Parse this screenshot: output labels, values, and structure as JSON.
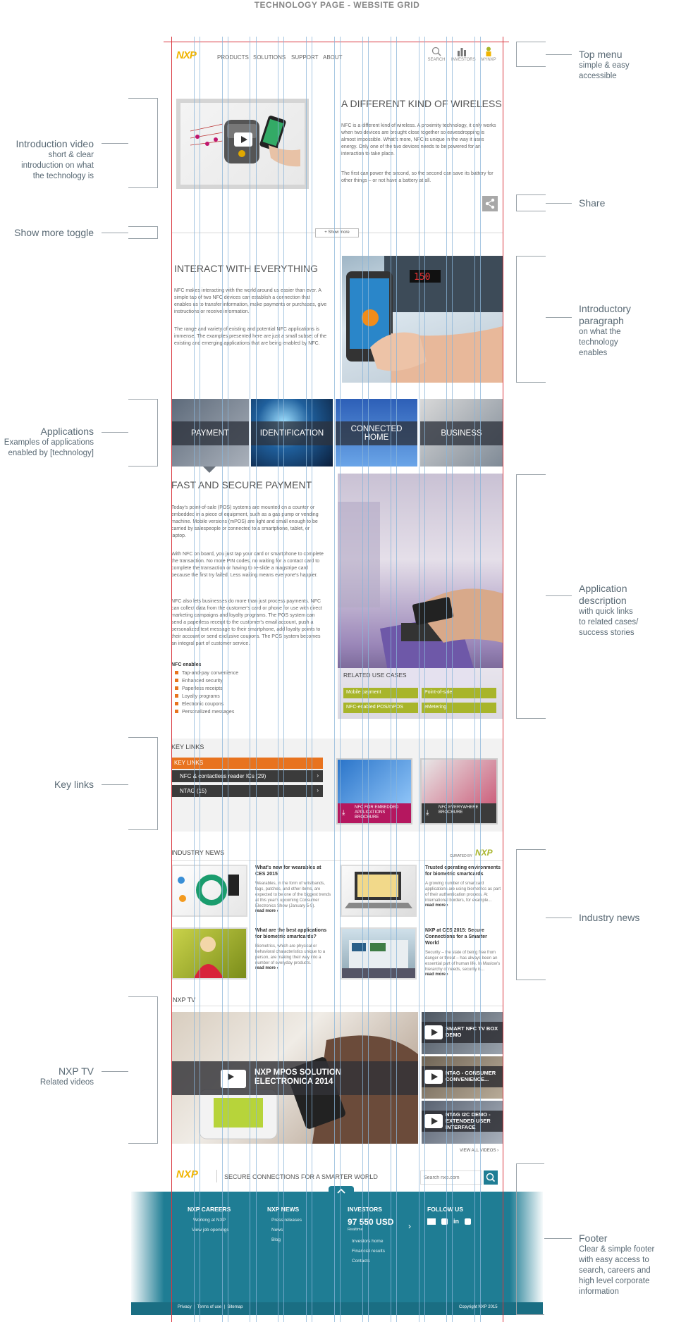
{
  "doc_title": "TECHNOLOGY PAGE - WEBSITE GRID",
  "annotations": {
    "top_menu": {
      "title": "Top menu",
      "lines": [
        "simple & easy",
        "accessible"
      ]
    },
    "intro_video": {
      "title": "Introduction video",
      "lines": [
        "short & clear",
        "introduction on what",
        "the technology is"
      ]
    },
    "share": {
      "title": "Share"
    },
    "show_more": {
      "title": "Show more toggle"
    },
    "intro_paragraph": {
      "title_lines": [
        "Introductory",
        "paragraph"
      ],
      "lines": [
        "on what the",
        "technology",
        "enables"
      ]
    },
    "applications": {
      "title": "Applications",
      "lines": [
        "Examples of applications",
        "enabled by [technology]"
      ]
    },
    "app_description": {
      "title_lines": [
        "Application",
        "description"
      ],
      "lines": [
        "with quick links",
        "to related cases/",
        "success stories"
      ]
    },
    "key_links": {
      "title": "Key links"
    },
    "industry_news": {
      "title": "Industry news"
    },
    "nxp_tv": {
      "title": "NXP TV",
      "lines": [
        "Related videos"
      ]
    },
    "footer": {
      "title": "Footer",
      "lines": [
        "Clear & simple footer",
        "with easy access to",
        "search, careers and",
        "high level corporate",
        "information"
      ]
    }
  },
  "nav": {
    "logo": "NXP",
    "items": [
      "PRODUCTS",
      "SOLUTIONS",
      "SUPPORT",
      "ABOUT"
    ],
    "icons": [
      {
        "label": "SEARCH",
        "icon": "search-icon"
      },
      {
        "label": "INVESTORS",
        "icon": "bar-chart-icon"
      },
      {
        "label": "MYNXP",
        "icon": "person-icon"
      }
    ]
  },
  "intro": {
    "title": "A DIFFERENT KIND OF WIRELESS",
    "p1": "NFC is a different kind of wireless. A proximity technology, it only works when two devices are brought close together so eavesdropping is almost impossible. What's more, NFC is unique in the way it uses energy. Only one of the two devices needs to be powered for an interaction to take place.",
    "p2": "The first can power the second, so the second can save its battery for other things – or not have a battery at all.",
    "show_more": "+ Show more"
  },
  "interact": {
    "title": "INTERACT WITH EVERYTHING",
    "p1": "NFC makes interacting with the world around us easier than ever. A simple tap of two NFC devices can establish a connection that enables us to transfer information, make payments or purchases, give instructions or receive information.",
    "p2": "The range and variety of existing and potential NFC applications is immense. The examples presented here are just a small subset of the existing and emerging applications that are being enabled by NFC."
  },
  "applications": [
    "PAYMENT",
    "IDENTIFICATION",
    "CONNECTED HOME",
    "BUSINESS"
  ],
  "payment": {
    "title": "FAST AND SECURE PAYMENT",
    "p1": "Today's point-of-sale (POS) systems are mounted on a counter or embedded in a piece of equipment, such as a gas pump or vending machine. Mobile versions (mPOS) are light and small enough to be carried by salespeople or connected to a smartphone, tablet, or laptop.",
    "p2": "With NFC on board, you just tap your card or smartphone to complete the transaction. No more PIN codes, no waiting for a contact card to complete the transaction or having to re-slide a magstripe card because the first try failed. Less waiting means everyone's happier.",
    "p3": "NFC also lets businesses do more than just process payments. NFC can collect data from the customer's card or phone for use with direct marketing campaigns and loyalty programs. The POS system can send a paperless receipt to the customer's email account, push a personalized text message to their smartphone, add loyalty points to their account or send exclusive coupons. The POS system becomes an integral part of customer service.",
    "enables_title": "NFC enables",
    "enables": [
      "Tap-and-pay convenience",
      "Enhanced security",
      "Paperless receipts",
      "Loyalty programs",
      "Electronic coupons",
      "Personalized messages"
    ],
    "related_title": "RELATED USE CASES",
    "related": [
      "Mobile payment",
      "Point-of-sale",
      "NFC-enabled POS/mPOS",
      "eMetering"
    ]
  },
  "key_links": {
    "title": "KEY LINKS",
    "header": "KEY LINKS",
    "rows": [
      "NFC & contactless reader ICs (29)",
      "NTAG (15)"
    ],
    "brochures": [
      "NFC FOR EMBEDDED APPLICATIONS BROCHURE",
      "NFC EVERYWHERE BROCHURE"
    ]
  },
  "news": {
    "title": "INDUSTRY NEWS",
    "curated": "CURATED BY",
    "read_more": "read more ›",
    "items": [
      {
        "title": "What's new for wearables at CES 2015",
        "body": "Wearables, in the form of wristbands, tags, patches, and other items, are expected to be one of the biggest trends at this year's upcoming Consumer Electronics Show (January 5-9)."
      },
      {
        "title": "Trusted operating environments for biometric smartcards",
        "body": "A growing number of smartcard applications are using biometrics as part of their authentication process. At international borders, for example..."
      },
      {
        "title": "What are the best applications for biometric smartcards?",
        "body": "Biometrics, which are physical or behavioral characteristics unique to a person, are making their way into a number of everyday products."
      },
      {
        "title": "NXP at CES 2015: Secure Connections for a Smarter World",
        "body": "Security – the state of being free from danger or threat – has always been an essential part of human life. In Maslow's hierarchy of needs, security is..."
      }
    ]
  },
  "tv": {
    "title": "NXP TV",
    "main": "NXP MPOS SOLUTION ELECTRONICA 2014",
    "side": [
      "SMART NFC TV BOX DEMO",
      "NTAG - CONSUMER CONVENIENCE...",
      "NTAG I2C DEMO - EXTENDED USER INTERFACE"
    ],
    "view_all": "VIEW ALL VIDEOS ›"
  },
  "footer": {
    "logo": "NXP",
    "tagline": "SECURE CONNECTIONS FOR A SMARTER WORLD",
    "search_placeholder": "Search nxp.com",
    "cols": [
      {
        "title": "NXP CAREERS",
        "links": [
          "Working at NXP",
          "View job openings"
        ]
      },
      {
        "title": "NXP NEWS",
        "links": [
          "Press releases",
          "News",
          "Blog"
        ]
      },
      {
        "title": "INVESTORS",
        "price": "97 550 USD",
        "price_note": "Realtime",
        "links": [
          "Investors home",
          "Financial results",
          "Contacts"
        ]
      },
      {
        "title": "FOLLOW US",
        "links": []
      }
    ],
    "bottom": [
      "Privacy",
      "Terms of use",
      "Sitemap"
    ],
    "copyright": "Copyright NXP 2015"
  },
  "colors": {
    "accent": "#a8b52a",
    "orange": "#e8731f",
    "footer": "#1f7d94",
    "grid": "#8ab4d8",
    "red": "#d9363e"
  }
}
